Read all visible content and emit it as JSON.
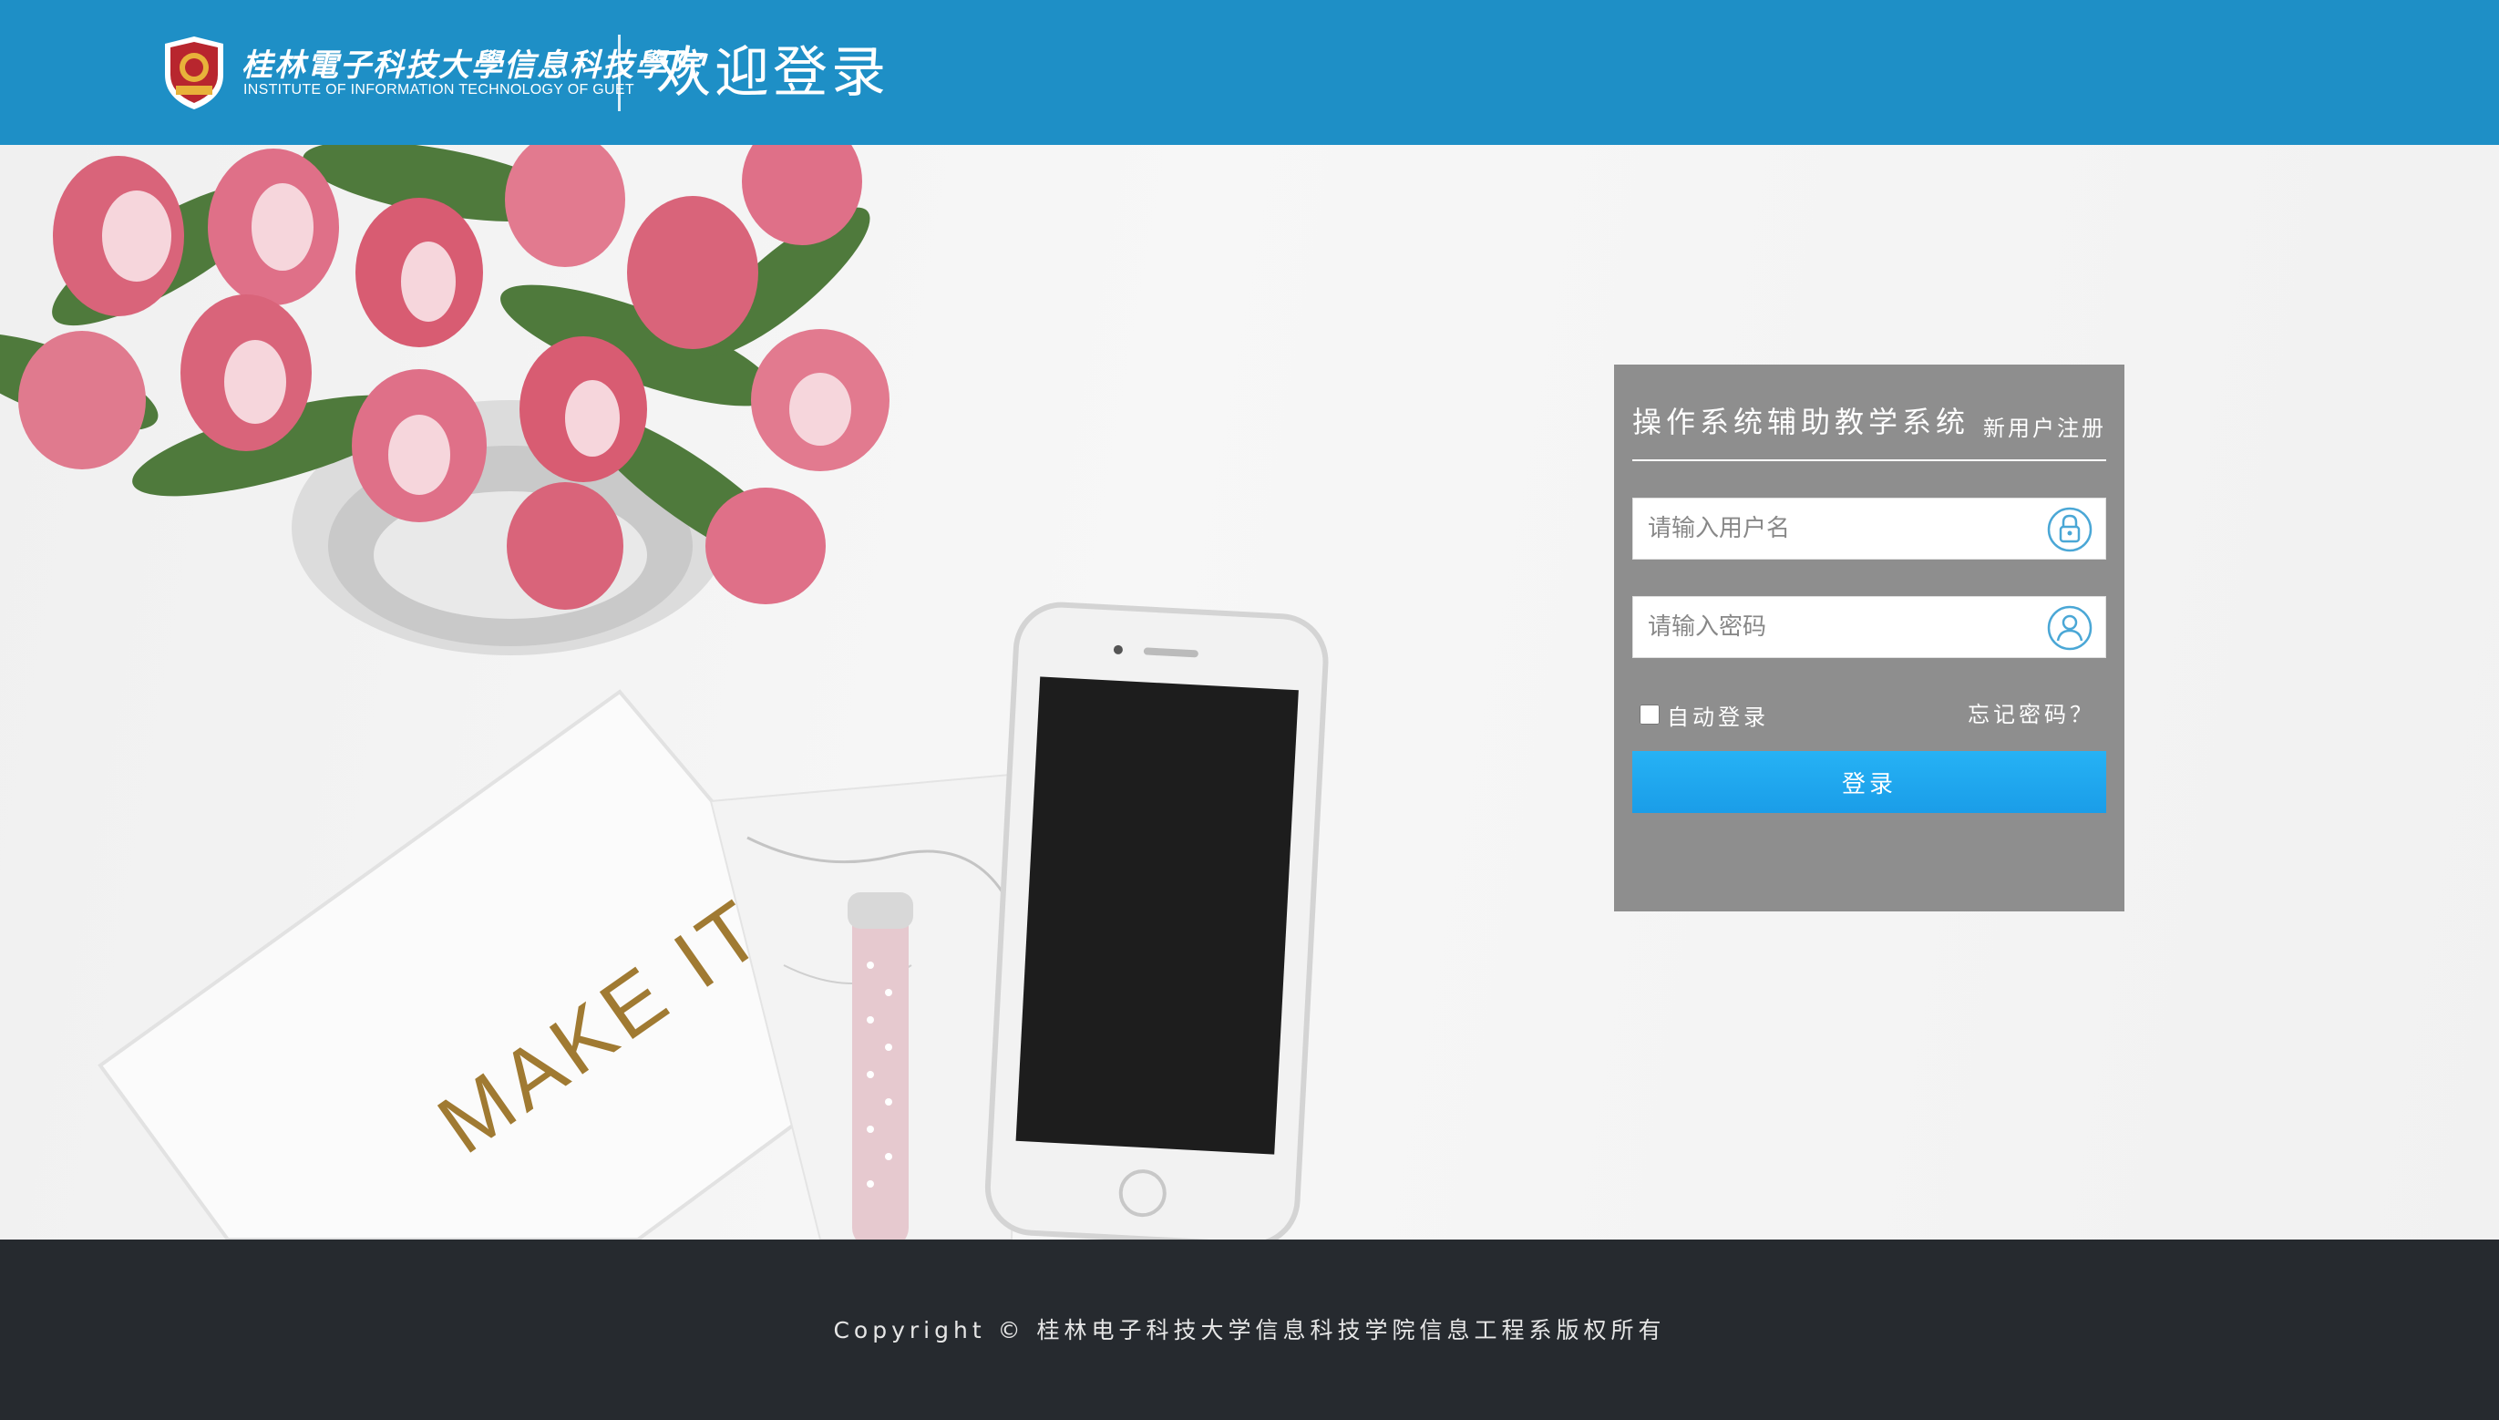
{
  "header": {
    "logo_cn": "桂林電子科技大學信息科技學院",
    "logo_en": "INSTITUTE OF INFORMATION TECHNOLOGY OF GUET",
    "title": "欢迎登录"
  },
  "hero": {
    "notebook_text": "MAKE IT"
  },
  "login": {
    "title": "操作系统辅助教学系统",
    "register_label": "新用户注册",
    "username_placeholder": "请输入用户名",
    "password_placeholder": "请输入密码",
    "remember_label": "自动登录",
    "forgot_label": "忘记密码？",
    "submit_label": "登录"
  },
  "footer": {
    "copyright": "Copyright  © 桂林电子科技大学信息科技学院信息工程系版权所有"
  },
  "icons": {
    "username_icon": "lock-icon",
    "password_icon": "user-icon"
  },
  "colors": {
    "header_bg": "#1e8fc6",
    "footer_bg": "#262a2f",
    "button": "#1fa5ee",
    "login_panel": "#808080"
  }
}
